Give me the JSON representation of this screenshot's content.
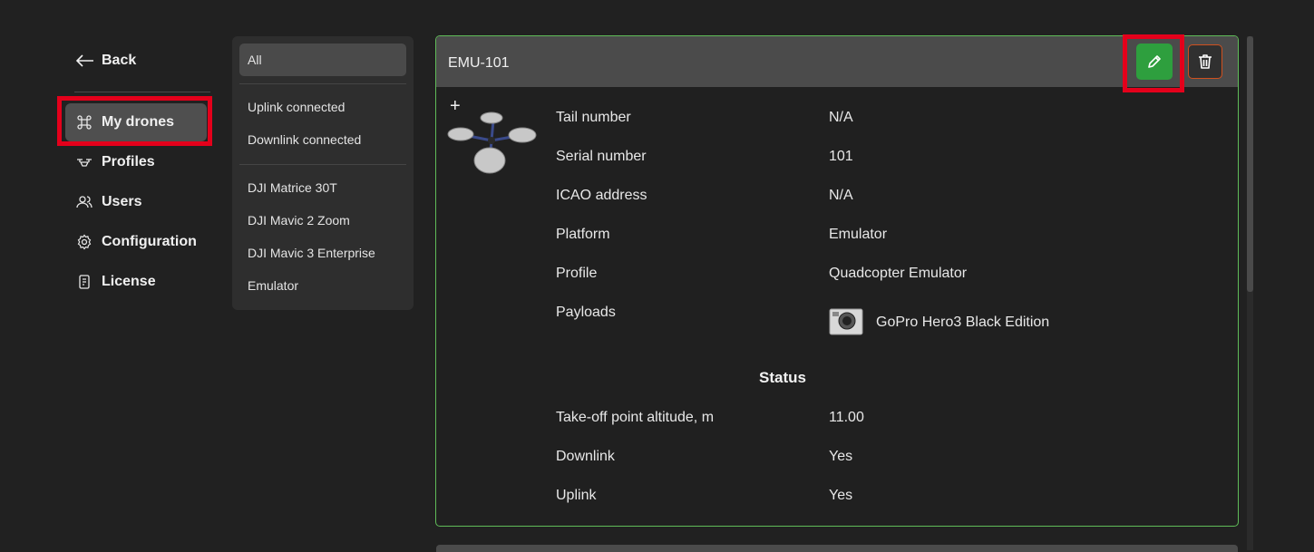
{
  "nav": {
    "back_label": "Back",
    "items": [
      {
        "label": "My drones",
        "icon": "command-icon",
        "active": true
      },
      {
        "label": "Profiles",
        "icon": "drone-profile-icon",
        "active": false
      },
      {
        "label": "Users",
        "icon": "users-icon",
        "active": false
      },
      {
        "label": "Configuration",
        "icon": "gear-icon",
        "active": false
      },
      {
        "label": "License",
        "icon": "license-icon",
        "active": false
      }
    ]
  },
  "filters": {
    "all": "All",
    "status": [
      "Uplink connected",
      "Downlink connected"
    ],
    "models": [
      "DJI Matrice 30T",
      "DJI Mavic 2 Zoom",
      "DJI Mavic 3 Enterprise",
      "Emulator"
    ]
  },
  "drone": {
    "name": "EMU-101",
    "fields": [
      {
        "label": "Tail number",
        "value": "N/A"
      },
      {
        "label": "Serial number",
        "value": "101"
      },
      {
        "label": "ICAO address",
        "value": "N/A"
      },
      {
        "label": "Platform",
        "value": "Emulator"
      },
      {
        "label": "Profile",
        "value": "Quadcopter Emulator"
      }
    ],
    "payloads_label": "Payloads",
    "payload_name": "GoPro Hero3 Black Edition",
    "status_heading": "Status",
    "status": [
      {
        "label": "Take-off point altitude, m",
        "value": "11.00"
      },
      {
        "label": "Downlink",
        "value": "Yes"
      },
      {
        "label": "Uplink",
        "value": "Yes"
      }
    ]
  },
  "colors": {
    "accent_green": "#2e9f3e",
    "card_border": "#5fbb58",
    "delete_border": "#d0501e",
    "highlight": "#e4001b"
  }
}
